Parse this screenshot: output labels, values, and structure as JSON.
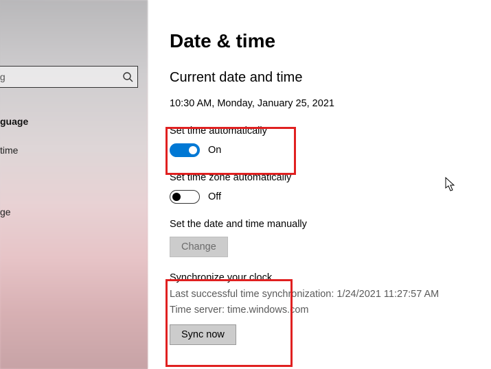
{
  "sidebar": {
    "search_placeholder": "ing",
    "items": [
      {
        "label": "guage",
        "active": true
      },
      {
        "label": "time",
        "active": false
      },
      {
        "label": "ge",
        "active": false
      }
    ]
  },
  "page": {
    "title": "Date & time",
    "section_current": "Current date and time",
    "current_value": "10:30 AM, Monday, January 25, 2021",
    "set_time_auto": {
      "label": "Set time automatically",
      "state": "On"
    },
    "set_tz_auto": {
      "label": "Set time zone automatically",
      "state": "Off"
    },
    "manual": {
      "label": "Set the date and time manually",
      "button": "Change"
    },
    "sync": {
      "title": "Synchronize your clock",
      "last": "Last successful time synchronization: 1/24/2021 11:27:57 AM",
      "server": "Time server: time.windows.com",
      "button": "Sync now"
    }
  }
}
